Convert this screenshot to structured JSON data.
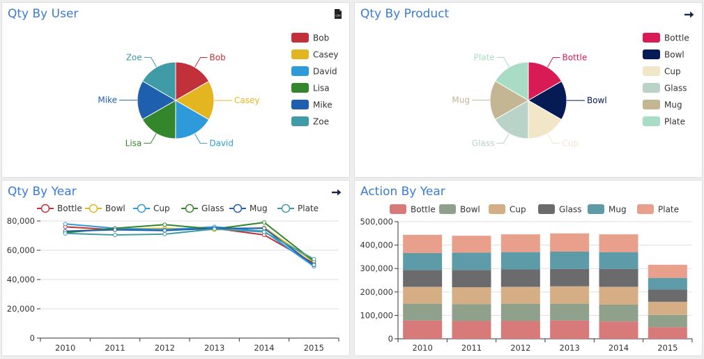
{
  "panels": {
    "user": {
      "title": "Qty By User",
      "toolbar_icon": "csv-file-icon"
    },
    "product": {
      "title": "Qty By Product",
      "toolbar_icon": "arrow-right-icon"
    },
    "year": {
      "title": "Qty By Year",
      "toolbar_icon": "arrow-right-icon"
    },
    "action": {
      "title": "Action By Year"
    }
  },
  "chart_data": [
    {
      "type": "pie",
      "title": "Qty By User",
      "labels": [
        "Bob",
        "Casey",
        "David",
        "Lisa",
        "Mike",
        "Zoe"
      ],
      "values": [
        16.7,
        16.7,
        16.7,
        16.7,
        16.7,
        16.6
      ],
      "colors": [
        "#c0313a",
        "#e3b621",
        "#2f9ad9",
        "#33862c",
        "#1e5fae",
        "#3f9ba6"
      ],
      "legend": "right"
    },
    {
      "type": "pie",
      "title": "Qty By Product",
      "labels": [
        "Bottle",
        "Bowl",
        "Cup",
        "Glass",
        "Mug",
        "Plate"
      ],
      "values": [
        16.7,
        16.7,
        16.7,
        16.7,
        16.7,
        16.6
      ],
      "colors": [
        "#d81b55",
        "#061a55",
        "#f2e6c9",
        "#b9d3c9",
        "#c4b693",
        "#a8dcc5"
      ],
      "legend": "right"
    },
    {
      "type": "line",
      "title": "Qty By Year",
      "categories": [
        "2010",
        "2011",
        "2012",
        "2013",
        "2014",
        "2015"
      ],
      "ylim": [
        0,
        80000
      ],
      "yticks": [
        "0",
        "20,000",
        "40,000",
        "60,000",
        "80,000"
      ],
      "series": [
        {
          "name": "Bottle",
          "color": "#c0313a",
          "values": [
            76000,
            74000,
            74000,
            75000,
            70500,
            51000
          ]
        },
        {
          "name": "Bowl",
          "color": "#e3b621",
          "values": [
            73000,
            74500,
            75000,
            74000,
            75500,
            52000
          ]
        },
        {
          "name": "Cup",
          "color": "#2f9ad9",
          "values": [
            78000,
            75000,
            74000,
            76000,
            73000,
            49000
          ]
        },
        {
          "name": "Glass",
          "color": "#33862c",
          "values": [
            72000,
            75000,
            77500,
            74500,
            79000,
            52500
          ]
        },
        {
          "name": "Mug",
          "color": "#1e5fae",
          "values": [
            73000,
            74000,
            73500,
            75000,
            75000,
            50000
          ]
        },
        {
          "name": "Plate",
          "color": "#3f9ba6",
          "values": [
            71500,
            70500,
            71000,
            74500,
            72500,
            54000
          ]
        }
      ],
      "legend": "top",
      "grid": true
    },
    {
      "type": "bar",
      "stacked": true,
      "title": "Action By Year",
      "categories": [
        "2010",
        "2011",
        "2012",
        "2013",
        "2014",
        "2015"
      ],
      "ylim": [
        0,
        500000
      ],
      "yticks": [
        "0",
        "100,000",
        "200,000",
        "300,000",
        "400,000",
        "500,000"
      ],
      "series": [
        {
          "name": "Bottle",
          "color": "#d87a7a",
          "values": [
            78000,
            76000,
            76000,
            78000,
            74000,
            50000
          ]
        },
        {
          "name": "Bowl",
          "color": "#8fa18b",
          "values": [
            72000,
            72000,
            74000,
            72000,
            72000,
            52000
          ]
        },
        {
          "name": "Cup",
          "color": "#d6ae86",
          "values": [
            72000,
            72000,
            72000,
            74000,
            76000,
            56000
          ]
        },
        {
          "name": "Glass",
          "color": "#6b6b6e",
          "values": [
            72000,
            74000,
            74000,
            74000,
            76000,
            52000
          ]
        },
        {
          "name": "Mug",
          "color": "#5e9ba8",
          "values": [
            72000,
            74000,
            74000,
            74000,
            72000,
            50000
          ]
        },
        {
          "name": "Plate",
          "color": "#e8a08c",
          "values": [
            78000,
            72000,
            76000,
            78000,
            76000,
            56000
          ]
        }
      ],
      "legend": "top",
      "grid": true
    }
  ]
}
